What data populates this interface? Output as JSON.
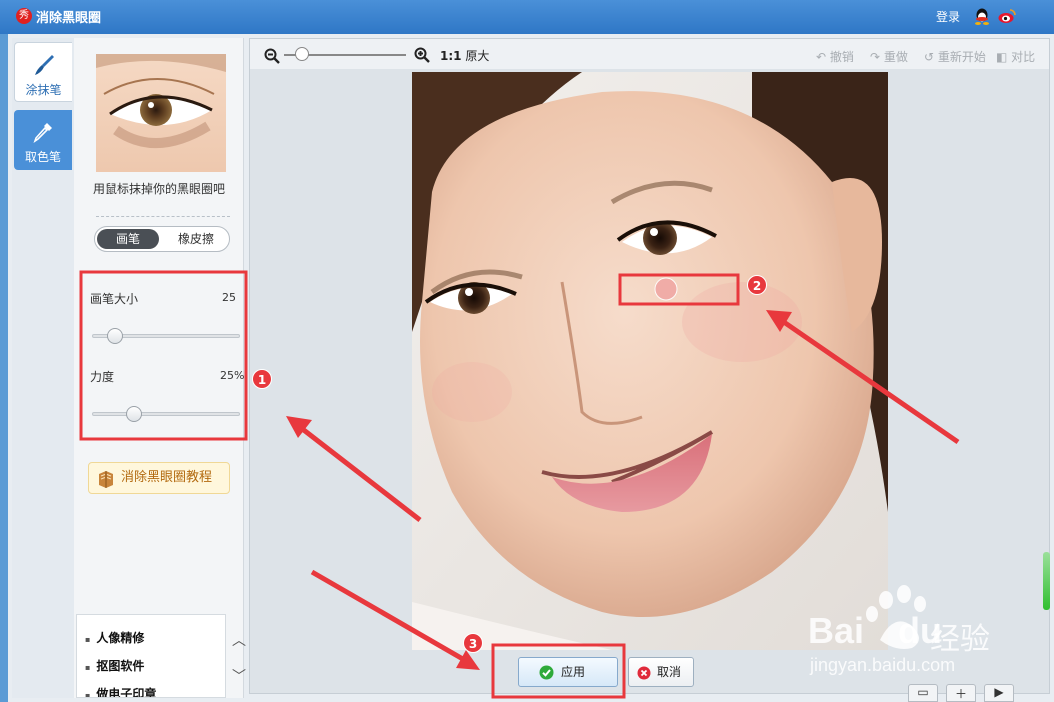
{
  "titlebar": {
    "logo_char": "秀",
    "title": "消除黑眼圈",
    "login": "登录"
  },
  "left_tabs": [
    {
      "label": "涂抹笔",
      "icon": "brush-icon",
      "active": true
    },
    {
      "label": "取色笔",
      "icon": "eyedropper-icon",
      "active": false
    }
  ],
  "panel": {
    "hint": "用鼠标抹掉你的黑眼圈吧",
    "toggle": {
      "on": "画笔",
      "off": "橡皮擦"
    },
    "brush_size": {
      "label": "画笔大小",
      "value": "25",
      "level": 0.15
    },
    "strength": {
      "label": "力度",
      "value": "25%",
      "level": 0.28
    },
    "tutorial": "消除黑眼圈教程",
    "menu": [
      "人像精修",
      "抠图软件",
      "做电子印章"
    ]
  },
  "toolbar": {
    "ratio_bold": "1:1",
    "ratio_text": "原大",
    "zoom_level": 0.15,
    "undo": "撤销",
    "redo": "重做",
    "restart": "重新开始",
    "compare": "对比"
  },
  "actions": {
    "apply": "应用",
    "cancel": "取消"
  },
  "annotations": {
    "badge1": "1",
    "badge2": "2",
    "badge3": "3",
    "color": "#e8383d"
  },
  "watermark": {
    "brand": "Bai",
    "brand2": "du",
    "cn": "经验",
    "url": "jingyan.baidu.com"
  }
}
